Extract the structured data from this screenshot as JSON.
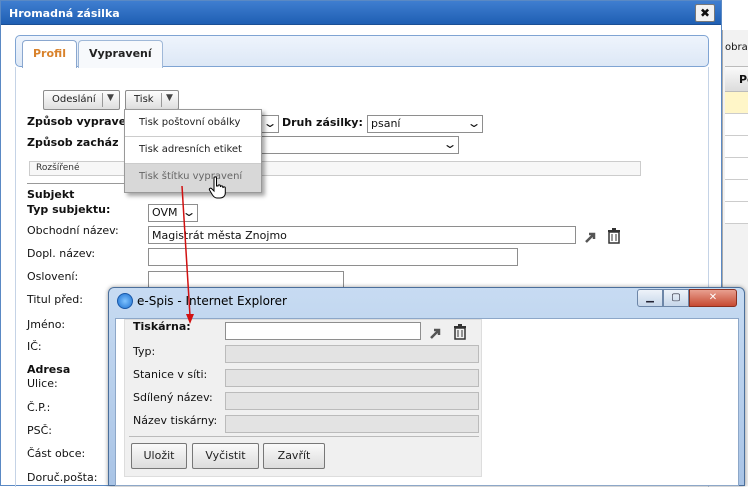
{
  "dialog": {
    "title": "Hromadná zásilka",
    "close": "✖"
  },
  "tabs": [
    {
      "label": "Profil"
    },
    {
      "label": "Vypravení"
    }
  ],
  "toolbar": {
    "odeslani": "Odeslání",
    "tisk": "Tisk"
  },
  "menu": {
    "items": [
      "Tisk poštovní obálky",
      "Tisk adresních etiket",
      "Tisk štítku vypravení"
    ]
  },
  "form": {
    "zpusob_vypraveni": "Způsob vyprave",
    "druh_zasilky_label": "Druh zásilky:",
    "druh_zasilky_value": "psaní",
    "zpusob_zachazeni": "Způsob zacház",
    "rozsirene": "Rozšířené",
    "subjekt": "Subjekt",
    "typ_subjektu_label": "Typ subjektu:",
    "typ_subjektu_value": "OVM",
    "obchodni_nazev_label": "Obchodní název:",
    "obchodni_nazev_value": "Magistrát města Znojmo",
    "dopl_nazev": "Dopl. název:",
    "osloveni": "Oslovení:",
    "titul_pred": "Titul před:",
    "jmeno": "Jméno:",
    "ic": "IČ:",
    "adresa": "Adresa",
    "ulice": "Ulice:",
    "cp": "Č.P.:",
    "psc": "PSČ:",
    "cast_obce": "Část obce:",
    "doruc_posta": "Doruč.pošta:"
  },
  "background_window": {
    "cut_text": "obraz",
    "header": "Po"
  },
  "ie_popup": {
    "title": "e-Spis - Internet Explorer",
    "tiskarna": "Tiskárna:",
    "typ": "Typ:",
    "stanice": "Stanice v síti:",
    "sdileny": "Sdílený název:",
    "nazev_tiskarny": "Název tiskárny:",
    "ulozit": "Uložit",
    "vycistit": "Vyčistit",
    "zavrit": "Zavřít"
  },
  "colors": {
    "titlebar": "#2a6cc2",
    "active_tab": "#d9822b",
    "annotation_arrow": "#d11111",
    "highlight_row": "#fff6c8"
  }
}
